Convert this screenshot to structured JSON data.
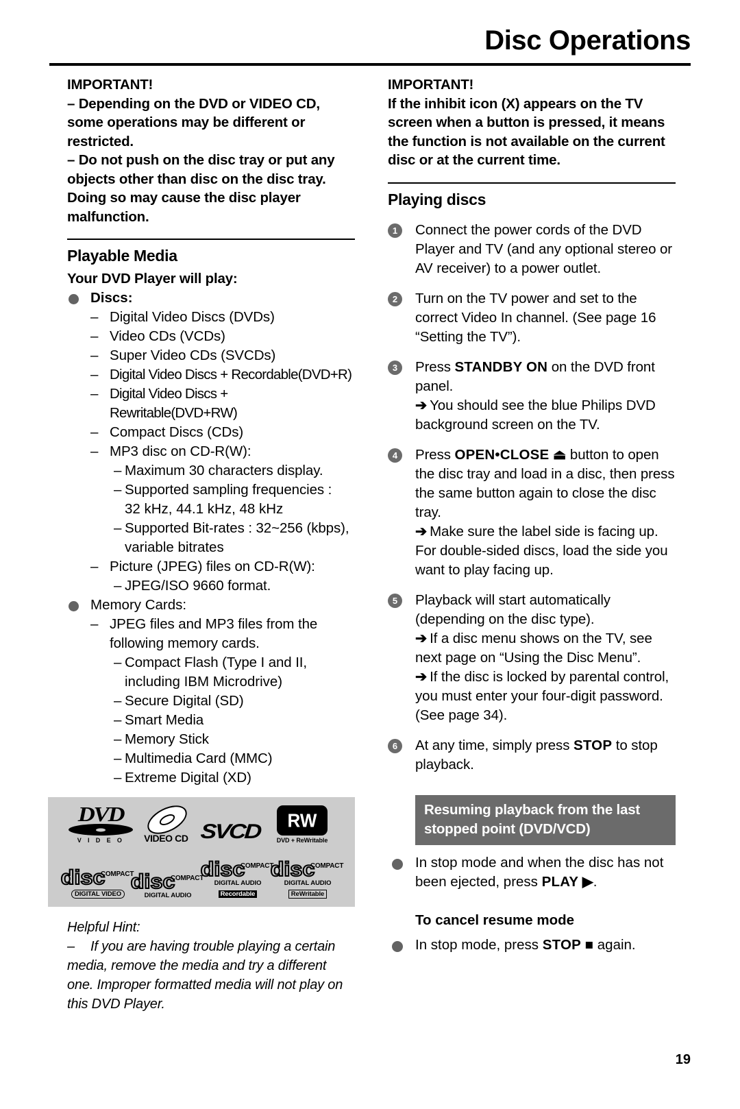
{
  "header": {
    "title": "Disc Operations"
  },
  "left": {
    "important_title": "IMPORTANT!",
    "important_items": [
      "–  Depending on the DVD or VIDEO CD, some operations may be different or restricted.",
      "–  Do not push on the disc tray or put any objects other than disc on the disc tray.  Doing so may cause the disc player malfunction."
    ],
    "playable_media_heading": "Playable Media",
    "will_play_heading": "Your DVD Player will play:",
    "discs_label": "Discs:",
    "disc_items": [
      "Digital Video Discs (DVDs)",
      "Video CDs (VCDs)",
      "Super Video CDs (SVCDs)",
      "Digital Video Discs + Recordable(DVD+R)",
      "Digital Video Discs + Rewritable(DVD+RW)",
      "Compact Discs (CDs)",
      "MP3 disc on CD-R(W):"
    ],
    "mp3_subitems": [
      "Maximum 30 characters display.",
      "Supported sampling frequencies :",
      "32 kHz, 44.1 kHz, 48 kHz",
      "Supported Bit-rates : 32~256 (kbps),",
      "variable bitrates"
    ],
    "jpeg_item": "Picture (JPEG) files on CD-R(W):",
    "jpeg_subitem": "JPEG/ISO 9660 format.",
    "memory_cards_label": "Memory Cards:",
    "memory_card_intro": "JPEG files and MP3 files from the following memory cards.",
    "memory_card_items": [
      "Compact Flash (Type I and II,",
      "including IBM Microdrive)",
      "Secure Digital (SD)",
      "Smart Media",
      "Memory Stick",
      "Multimedia Card (MMC)",
      "Extreme Digital (XD)"
    ],
    "logos": [
      {
        "name": "dvd-video-logo",
        "word": "DVD",
        "sub": "V I D E O"
      },
      {
        "name": "video-cd-logo",
        "sub": "VIDEO CD"
      },
      {
        "name": "svcd-logo",
        "word": "SVCD"
      },
      {
        "name": "dvd-rewritable-logo",
        "word": "RW",
        "sub": "DVD + ReWritable"
      },
      {
        "name": "compact-disc-digital-video-logo",
        "word": "disc",
        "top": "COMPACT",
        "sub": "DIGITAL VIDEO"
      },
      {
        "name": "compact-disc-digital-audio-logo",
        "word": "disc",
        "top": "COMPACT",
        "sub": "DIGITAL AUDIO"
      },
      {
        "name": "compact-disc-recordable-logo",
        "word": "disc",
        "top": "COMPACT",
        "sub": "DIGITAL AUDIO",
        "sub2": "Recordable"
      },
      {
        "name": "compact-disc-rewritable-logo",
        "word": "disc",
        "top": "COMPACT",
        "sub": "DIGITAL AUDIO",
        "sub2": "ReWritable"
      }
    ],
    "hint_title": "Helpful Hint:",
    "hint_dash": "–",
    "hint_body": "If you are having trouble playing a certain media, remove the media and try a different one.  Improper formatted media will not play on this DVD Player."
  },
  "right": {
    "important_title": "IMPORTANT!",
    "important_body": "If the inhibit icon (X) appears on the TV screen when a button is pressed, it means the function is not available on the current disc or at the current time.",
    "playing_discs_heading": "Playing discs",
    "steps": [
      {
        "num": "1",
        "text": "Connect the power cords of the DVD Player and TV (and any optional stereo or AV receiver) to a power outlet.",
        "notes": []
      },
      {
        "num": "2",
        "text": "Turn on the TV power and set to the correct Video In channel.  (See page 16 “Setting the TV”).",
        "notes": []
      },
      {
        "num": "3",
        "pre": "Press ",
        "kw": "STANDBY ON",
        "post": " on the DVD front panel.",
        "notes": [
          "You should see the blue Philips DVD background screen on the TV."
        ]
      },
      {
        "num": "4",
        "pre": "Press ",
        "kw": "OPEN•CLOSE",
        "kw_icon": "⏏",
        "post": " button to open the disc tray and load in a disc, then press the same button again to close the disc tray.",
        "notes": [
          "Make sure the label side is facing up. For double-sided discs, load the side you want to play facing up."
        ]
      },
      {
        "num": "5",
        "text": "Playback will start automatically (depending on the disc type).",
        "notes": [
          "If a disc menu shows on the TV, see next page on “Using the Disc Menu”.",
          "If the disc is locked by parental control, you must enter your four-digit password. (See page 34)."
        ]
      },
      {
        "num": "6",
        "pre": "At any time, simply press ",
        "kw": "STOP",
        "post": " to stop playback.",
        "notes": []
      }
    ],
    "banner": "Resuming playback from the last stopped point (DVD/VCD)",
    "resume_bullet_pre": "In stop mode and when the disc has not been ejected, press ",
    "resume_bullet_kw": "PLAY",
    "resume_bullet_icon": "▶",
    "resume_bullet_post": ".",
    "cancel_heading": "To cancel resume mode",
    "cancel_bullet_pre": "In stop mode, press ",
    "cancel_bullet_kw": "STOP",
    "cancel_bullet_icon": "■",
    "cancel_bullet_post": " again."
  },
  "page_number": "19"
}
